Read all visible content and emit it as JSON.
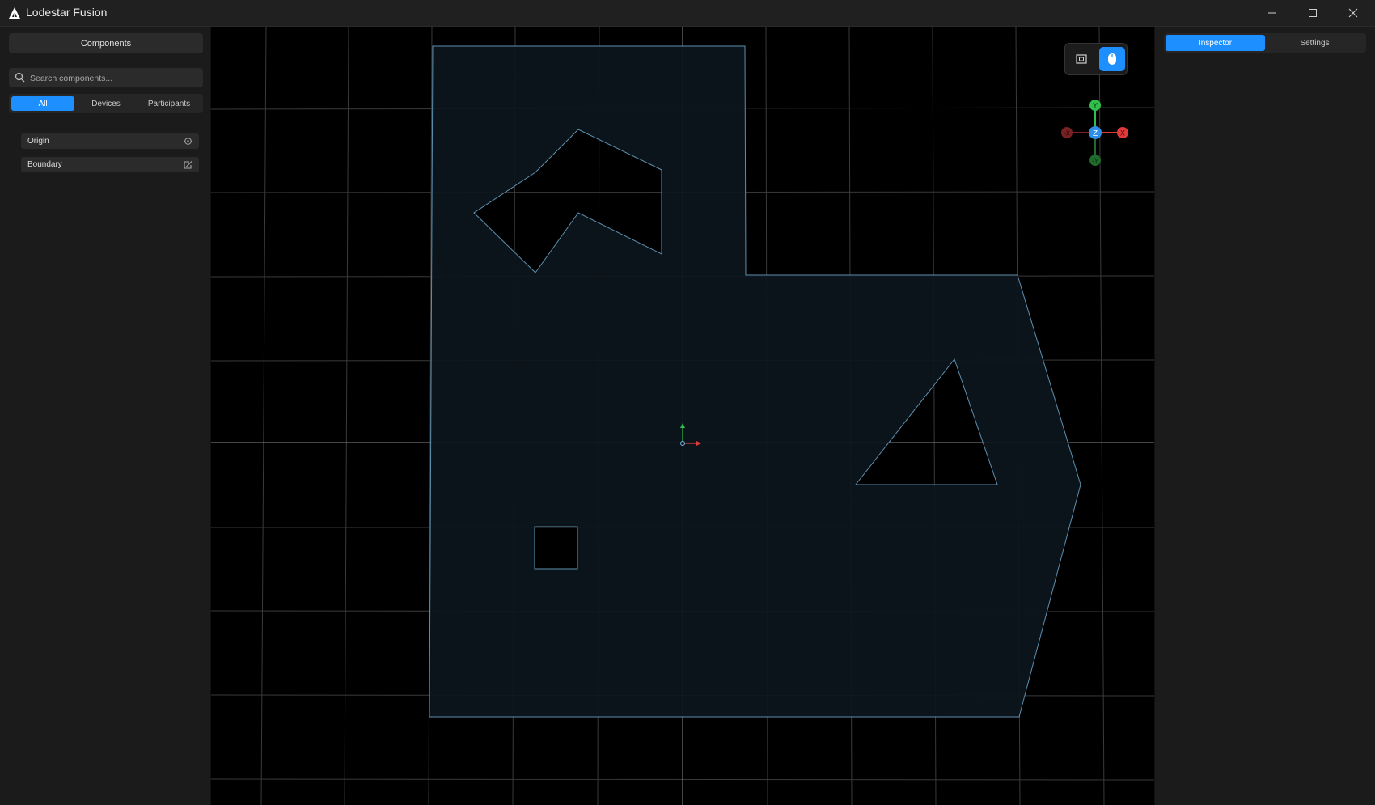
{
  "window": {
    "title": "Lodestar Fusion",
    "controls": {
      "minimize": "minimize-icon",
      "maximize": "maximize-icon",
      "close": "close-icon"
    }
  },
  "left_panel": {
    "header": "Components",
    "search": {
      "placeholder": "Search components...",
      "value": ""
    },
    "filters": [
      {
        "label": "All",
        "active": true
      },
      {
        "label": "Devices",
        "active": false
      },
      {
        "label": "Participants",
        "active": false
      }
    ],
    "components": [
      {
        "label": "Origin",
        "icon": "crosshair-icon"
      },
      {
        "label": "Boundary",
        "icon": "boundary-edit-icon"
      }
    ]
  },
  "viewport": {
    "toolbar": [
      {
        "icon": "frame-view-icon",
        "active": false
      },
      {
        "icon": "mouse-icon",
        "active": true
      }
    ],
    "gizmo": {
      "pos_y": "Y",
      "neg_y": "-Y",
      "pos_x": "X",
      "neg_x": "-X",
      "z": "Z"
    }
  },
  "right_panel": {
    "tabs": [
      {
        "label": "Inspector",
        "active": true
      },
      {
        "label": "Settings",
        "active": false
      }
    ]
  },
  "colors": {
    "accent": "#1e8fff",
    "boundary_stroke": "#5d8fb0",
    "boundary_fill": "#0c161c",
    "axis_x": "#e03a3a",
    "axis_y": "#2fbf4a",
    "axis_z": "#2f8fe6"
  }
}
